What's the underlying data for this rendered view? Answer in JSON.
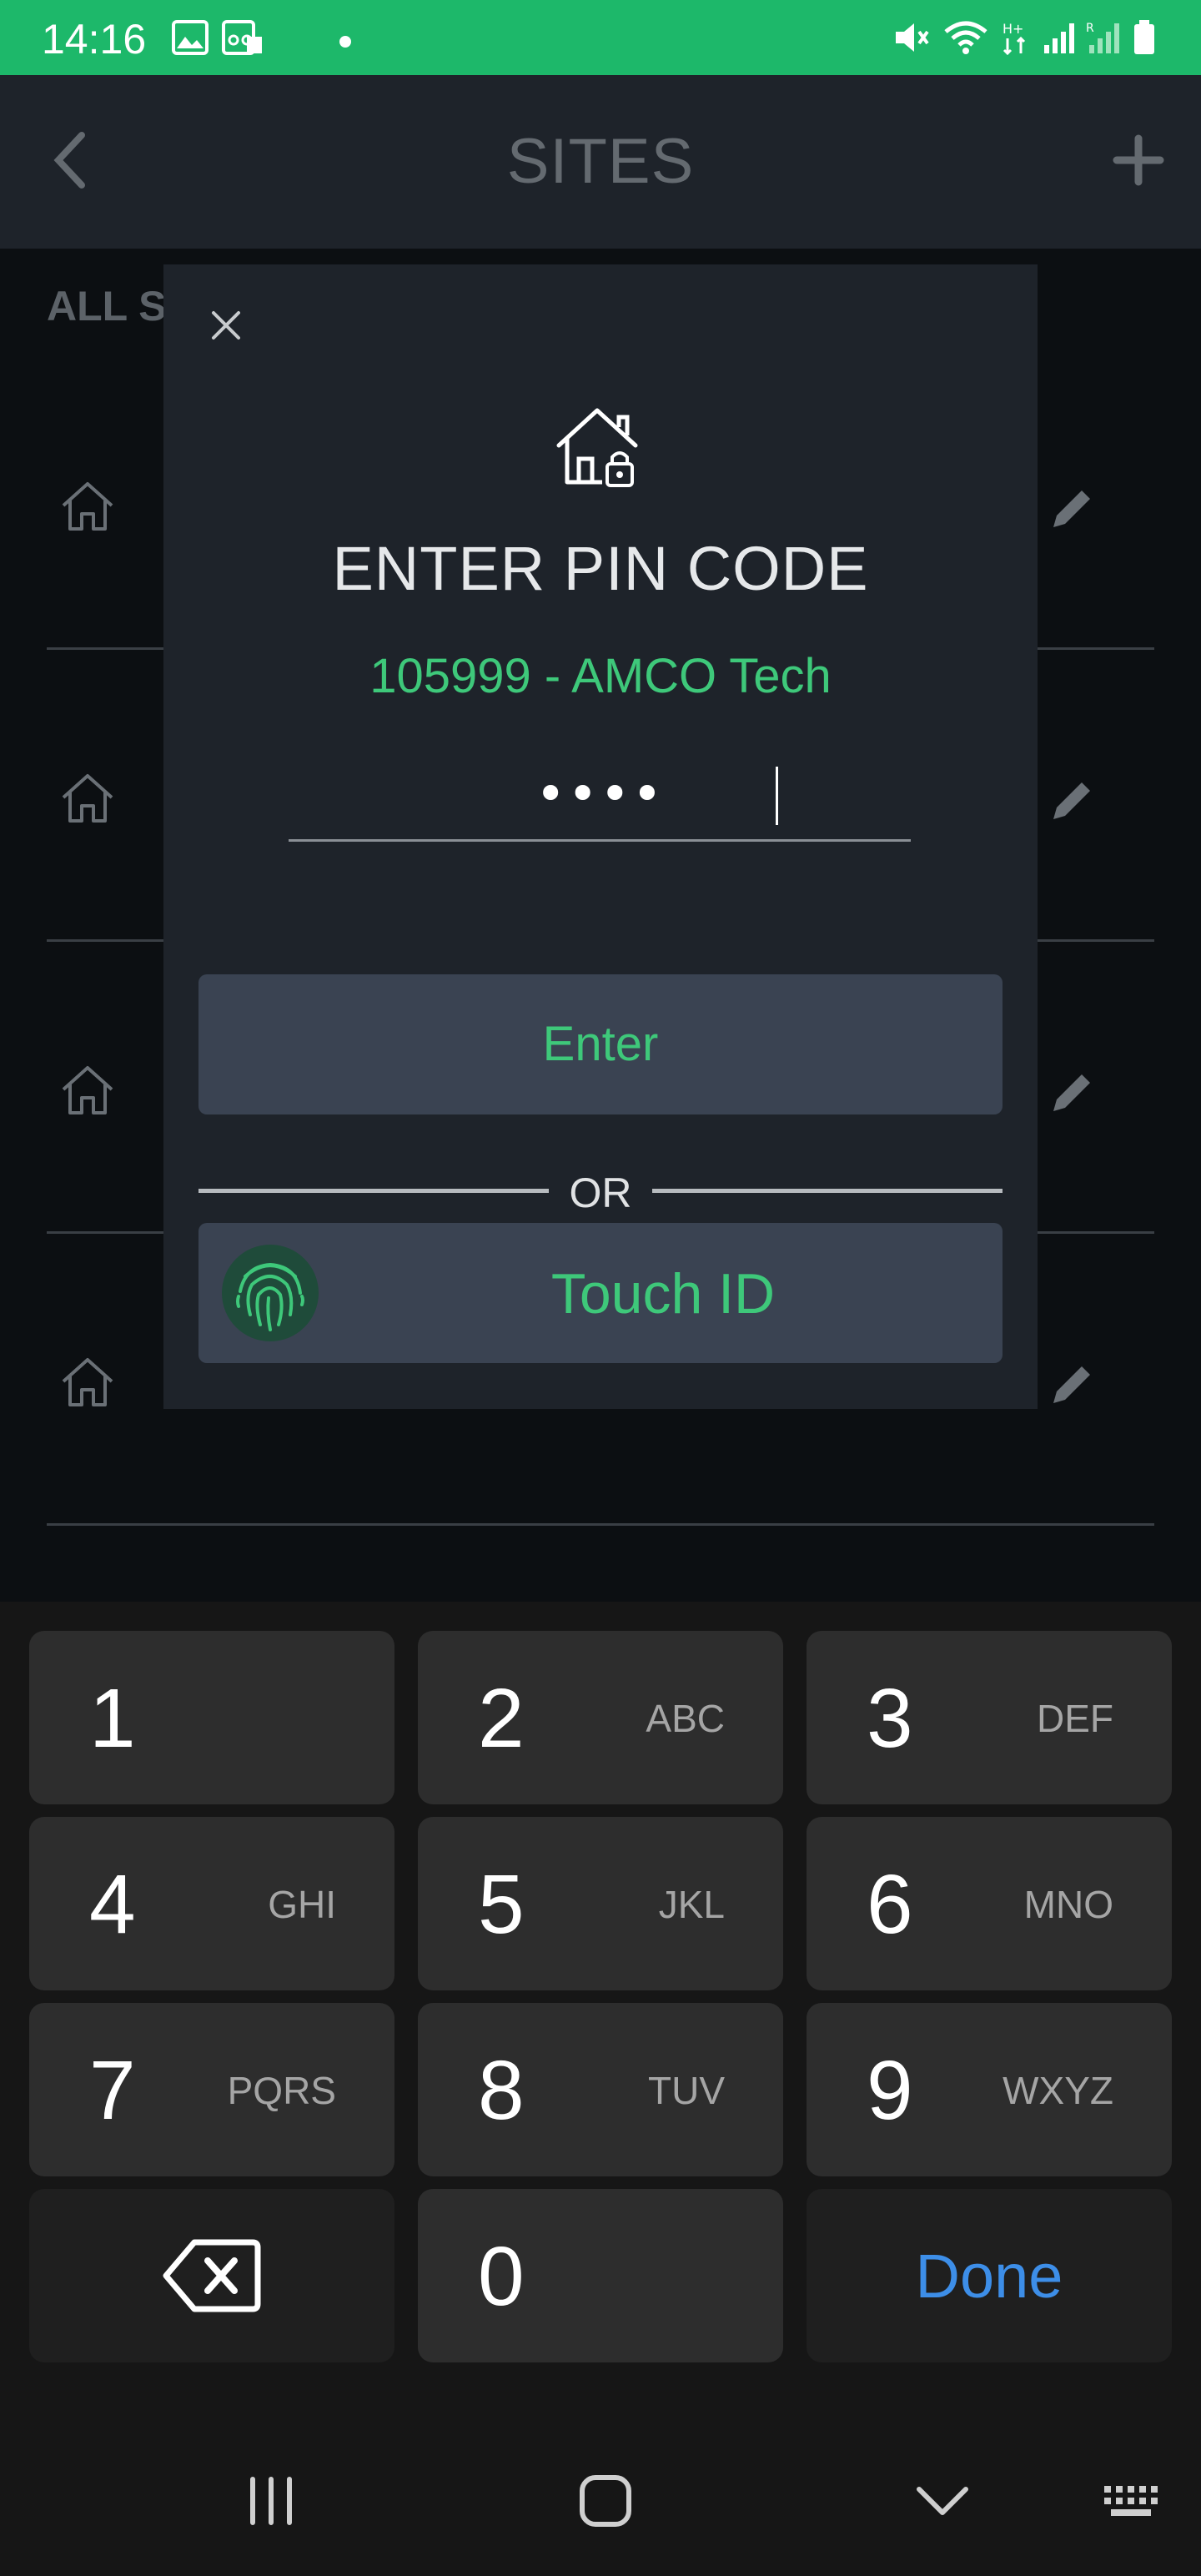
{
  "status_bar": {
    "time": "14:16",
    "color": "#1db86a",
    "icons": [
      "image-icon",
      "voicemail-icon",
      "dot-icon",
      "mute-icon",
      "wifi-icon",
      "data-arrows-icon",
      "signal-icon",
      "signal-roaming-icon",
      "battery-icon"
    ]
  },
  "header": {
    "title": "SITES",
    "back_icon": "chevron-left-icon",
    "add_icon": "plus-icon"
  },
  "background": {
    "section_label": "ALL S",
    "rows": [
      {
        "icon": "home-icon",
        "action_icon": "pencil-icon"
      },
      {
        "icon": "home-icon",
        "action_icon": "pencil-icon"
      },
      {
        "icon": "home-icon",
        "action_icon": "pencil-icon"
      },
      {
        "icon": "home-icon",
        "action_icon": "pencil-icon"
      }
    ]
  },
  "modal": {
    "close_icon": "close-icon",
    "header_icon": "house-lock-icon",
    "title": "ENTER PIN CODE",
    "site_name": "105999 - AMCO Tech",
    "pin_value": "••••",
    "enter_label": "Enter",
    "or_label": "OR",
    "touch_label": "Touch ID",
    "touch_icon": "fingerprint-icon",
    "accent": "#3ec87a"
  },
  "keyboard": {
    "keys": [
      {
        "num": "1",
        "letters": ""
      },
      {
        "num": "2",
        "letters": "ABC"
      },
      {
        "num": "3",
        "letters": "DEF"
      },
      {
        "num": "4",
        "letters": "GHI"
      },
      {
        "num": "5",
        "letters": "JKL"
      },
      {
        "num": "6",
        "letters": "MNO"
      },
      {
        "num": "7",
        "letters": "PQRS"
      },
      {
        "num": "8",
        "letters": "TUV"
      },
      {
        "num": "9",
        "letters": "WXYZ"
      },
      {
        "num": "0",
        "letters": ""
      }
    ],
    "backspace_icon": "backspace-icon",
    "done_label": "Done",
    "done_color": "#3d8ee8"
  },
  "nav_bar": {
    "icons": [
      "recents-icon",
      "home-button-icon",
      "hide-keyboard-icon",
      "keyboard-icon"
    ]
  }
}
